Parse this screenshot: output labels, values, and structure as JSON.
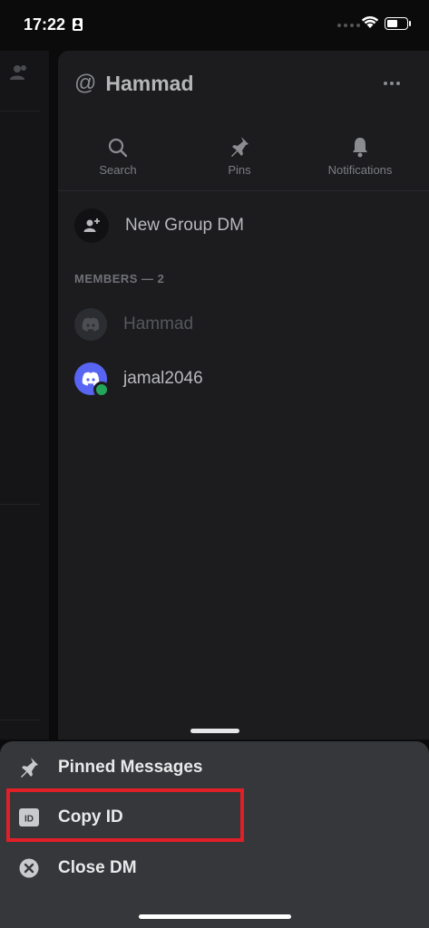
{
  "status": {
    "time": "17:22"
  },
  "dm": {
    "at": "@",
    "username": "Hammad",
    "actions": [
      {
        "label": "Search",
        "icon": "search-icon"
      },
      {
        "label": "Pins",
        "icon": "pin-icon"
      },
      {
        "label": "Notifications",
        "icon": "bell-icon"
      }
    ],
    "new_group_label": "New Group DM",
    "members_header": "MEMBERS — 2",
    "members": [
      {
        "name": "Hammad",
        "status": "offline"
      },
      {
        "name": "jamal2046",
        "status": "online"
      }
    ]
  },
  "sheet": {
    "items": [
      {
        "label": "Pinned Messages",
        "icon": "pin-icon"
      },
      {
        "label": "Copy ID",
        "icon": "id-icon",
        "highlighted": true
      },
      {
        "label": "Close DM",
        "icon": "close-circle-icon"
      }
    ]
  },
  "colors": {
    "accent_blurple": "#5865f2",
    "online_green": "#23a55a",
    "highlight_red": "#e01f27"
  }
}
